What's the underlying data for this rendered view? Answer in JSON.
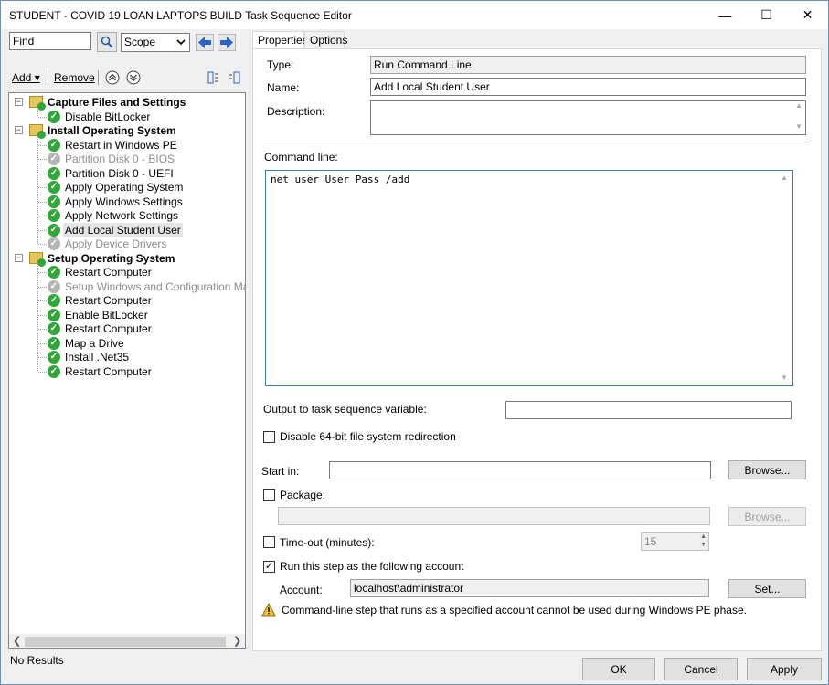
{
  "window": {
    "title": "STUDENT - COVID 19 LOAN LAPTOPS BUILD Task Sequence Editor",
    "minimize_glyph": "—",
    "maximize_glyph": "☐",
    "close_glyph": "✕"
  },
  "toolbar": {
    "find_value": "Find",
    "scope_value": "Scope",
    "add_label": "Add",
    "remove_label": "Remove"
  },
  "tree": {
    "groups": [
      {
        "label": "Capture Files and Settings",
        "items": [
          {
            "label": "Disable BitLocker",
            "disabled": false
          }
        ]
      },
      {
        "label": "Install Operating System",
        "items": [
          {
            "label": "Restart in Windows PE",
            "disabled": false
          },
          {
            "label": "Partition Disk 0 - BIOS",
            "disabled": true
          },
          {
            "label": "Partition Disk 0 - UEFI",
            "disabled": false
          },
          {
            "label": "Apply Operating System",
            "disabled": false
          },
          {
            "label": "Apply Windows Settings",
            "disabled": false
          },
          {
            "label": "Apply Network Settings",
            "disabled": false
          },
          {
            "label": "Add Local Student User",
            "disabled": false,
            "selected": true
          },
          {
            "label": "Apply Device Drivers",
            "disabled": true
          }
        ]
      },
      {
        "label": "Setup Operating System",
        "items": [
          {
            "label": "Restart Computer",
            "disabled": false
          },
          {
            "label": "Setup Windows and Configuration Manager",
            "disabled": true
          },
          {
            "label": "Restart Computer",
            "disabled": false
          },
          {
            "label": "Enable BitLocker",
            "disabled": false
          },
          {
            "label": "Restart Computer",
            "disabled": false
          },
          {
            "label": "Map a Drive",
            "disabled": false
          },
          {
            "label": "Install .Net35",
            "disabled": false
          },
          {
            "label": "Restart Computer",
            "disabled": false
          }
        ]
      }
    ]
  },
  "status": {
    "text": "No Results"
  },
  "tabs": {
    "properties": "Properties",
    "options": "Options"
  },
  "properties": {
    "type_label": "Type:",
    "type_value": "Run Command Line",
    "name_label": "Name:",
    "name_value": "Add Local Student User",
    "description_label": "Description:",
    "description_value": "",
    "command_label": "Command line:",
    "command_value": "net user User Pass /add",
    "output_label": "Output to task sequence variable:",
    "output_value": "",
    "disable64_label": "Disable 64-bit file system redirection",
    "disable64_checked": false,
    "startin_label": "Start in:",
    "startin_value": "",
    "browse_label": "Browse...",
    "package_label": "Package:",
    "package_checked": false,
    "package_value": "",
    "browse2_label": "Browse...",
    "timeout_label": "Time-out (minutes):",
    "timeout_checked": false,
    "timeout_value": "15",
    "runas_label": "Run this step as the following account",
    "runas_checked": true,
    "account_label": "Account:",
    "account_value": "localhost\\administrator",
    "set_label": "Set...",
    "warning_text": "Command-line step that runs as a specified account cannot be used during Windows PE phase."
  },
  "footer": {
    "ok": "OK",
    "cancel": "Cancel",
    "apply": "Apply"
  }
}
